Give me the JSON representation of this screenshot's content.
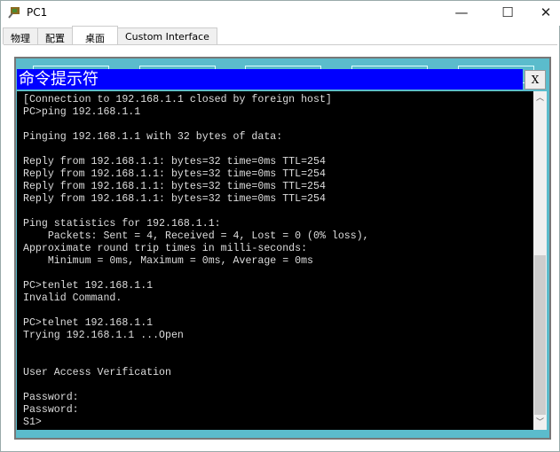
{
  "window": {
    "title": "PC1",
    "minimize": "—",
    "maximize": "☐",
    "close": "✕"
  },
  "tabs": [
    {
      "label": "物理"
    },
    {
      "label": "配置"
    },
    {
      "label": "桌面"
    },
    {
      "label": "Custom Interface"
    }
  ],
  "active_tab": "桌面",
  "cmd": {
    "title": "命令提示符",
    "close_label": "X",
    "lines": [
      "[Connection to 192.168.1.1 closed by foreign host]",
      "PC>ping 192.168.1.1",
      "",
      "Pinging 192.168.1.1 with 32 bytes of data:",
      "",
      "Reply from 192.168.1.1: bytes=32 time=0ms TTL=254",
      "Reply from 192.168.1.1: bytes=32 time=0ms TTL=254",
      "Reply from 192.168.1.1: bytes=32 time=0ms TTL=254",
      "Reply from 192.168.1.1: bytes=32 time=0ms TTL=254",
      "",
      "Ping statistics for 192.168.1.1:",
      "    Packets: Sent = 4, Received = 4, Lost = 0 (0% loss),",
      "Approximate round trip times in milli-seconds:",
      "    Minimum = 0ms, Maximum = 0ms, Average = 0ms",
      "",
      "PC>tenlet 192.168.1.1",
      "Invalid Command.",
      "",
      "PC>telnet 192.168.1.1",
      "Trying 192.168.1.1 ...Open",
      "",
      "",
      "User Access Verification",
      "",
      "Password: ",
      "Password: ",
      "S1>"
    ]
  },
  "colors": {
    "cmd_title_bg": "#0000ff",
    "desktop_bg": "#5bbccc",
    "terminal_bg": "#000000"
  }
}
